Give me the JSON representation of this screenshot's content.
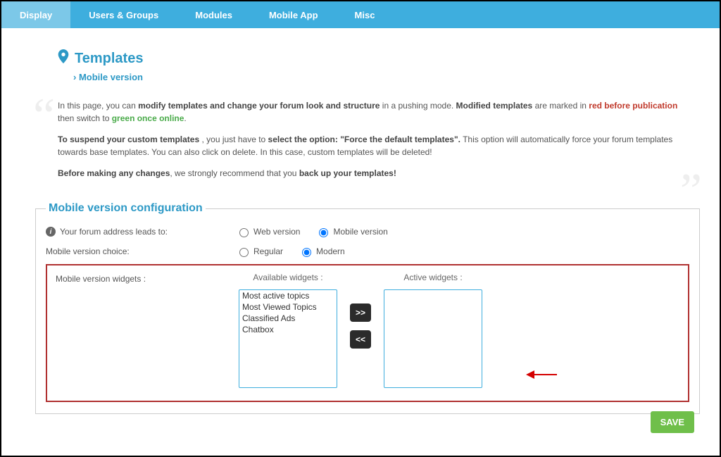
{
  "nav": {
    "items": [
      {
        "label": "Display",
        "active": true
      },
      {
        "label": "Users & Groups",
        "active": false
      },
      {
        "label": "Modules",
        "active": false
      },
      {
        "label": "Mobile App",
        "active": false
      },
      {
        "label": "Misc",
        "active": false
      }
    ]
  },
  "header": {
    "title": "Templates",
    "breadcrumb": "Mobile version"
  },
  "intro": {
    "p1_a": "In this page, you can ",
    "p1_b": "modify templates and change your forum look and structure",
    "p1_c": " in a pushing mode. ",
    "p1_d": "Modified templates",
    "p1_e": " are marked in ",
    "p1_red": "red before publication",
    "p1_f": " then switch to ",
    "p1_green": "green once online",
    "p1_g": ".",
    "p2_a": "To suspend your custom templates",
    "p2_b": " , you just have to ",
    "p2_c": "select the option: \"Force the default templates\".",
    "p2_d": " This option will automatically force your forum templates towards base templates. You can also click on delete. In this case, custom templates will be deleted!",
    "p3_a": "Before making any changes",
    "p3_b": ", we strongly recommend that you ",
    "p3_c": "back up your templates!"
  },
  "config": {
    "legend": "Mobile version configuration",
    "row1": {
      "label": "Your forum address leads to:",
      "opt1": "Web version",
      "opt2": "Mobile version",
      "selected": "mobile"
    },
    "row2": {
      "label": "Mobile version choice:",
      "opt1": "Regular",
      "opt2": "Modern",
      "selected": "modern"
    },
    "widgets": {
      "label": "Mobile version widgets :",
      "available_hdr": "Available widgets :",
      "active_hdr": "Active widgets :",
      "available": [
        "Most active topics",
        "Most Viewed Topics",
        "Classified Ads",
        "Chatbox"
      ],
      "active": [],
      "move_right": ">>",
      "move_left": "<<"
    }
  },
  "buttons": {
    "save": "SAVE"
  }
}
